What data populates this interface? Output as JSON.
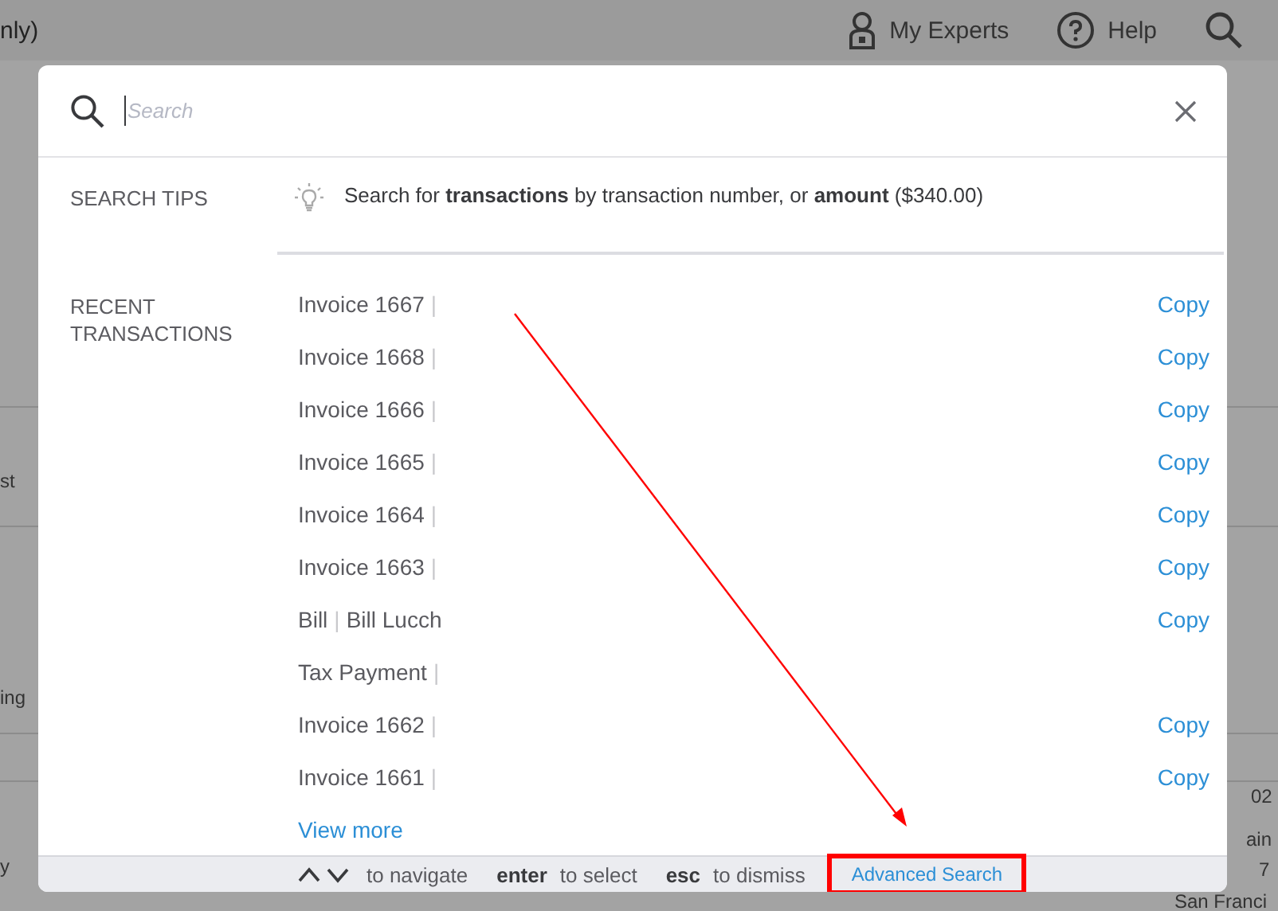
{
  "header": {
    "title": "nly)",
    "experts_label": "My Experts",
    "help_label": "Help"
  },
  "background": {
    "left_fragments": [
      "st",
      "ing",
      "y"
    ],
    "right_fragments": [
      "02",
      "ain",
      "7",
      "San Franci"
    ]
  },
  "search": {
    "placeholder": "Search"
  },
  "tips": {
    "label": "SEARCH TIPS",
    "text": "Search for **transactions** by transaction number, or **amount** ($340.00)"
  },
  "recent": {
    "label": "RECENT TRANSACTIONS",
    "rows": [
      {
        "name": "Invoice 1667",
        "separator": "|",
        "copy": "Copy"
      },
      {
        "name": "Invoice 1668",
        "separator": "|",
        "copy": "Copy"
      },
      {
        "name": "Invoice 1666",
        "separator": "|",
        "copy": "Copy"
      },
      {
        "name": "Invoice 1665",
        "separator": "|",
        "copy": "Copy"
      },
      {
        "name": "Invoice 1664",
        "separator": "|",
        "copy": "Copy"
      },
      {
        "name": "Invoice 1663",
        "separator": "|",
        "copy": "Copy"
      },
      {
        "name": "Bill",
        "separator": "|",
        "detail": "Bill Lucch",
        "copy": "Copy"
      },
      {
        "name": "Tax Payment",
        "separator": "|"
      },
      {
        "name": "Invoice 1662",
        "separator": "|",
        "copy": "Copy"
      },
      {
        "name": "Invoice 1661",
        "separator": "|",
        "copy": "Copy"
      }
    ],
    "view_more": "View more"
  },
  "footer": {
    "nav_text": "to navigate",
    "hints": [
      {
        "key": "enter",
        "action": "to select"
      },
      {
        "key": "esc",
        "action": "to dismiss"
      }
    ],
    "advanced_search": {
      "label": "Advanced Search",
      "highlighted": true
    }
  },
  "annotation": {
    "arrow": true
  }
}
